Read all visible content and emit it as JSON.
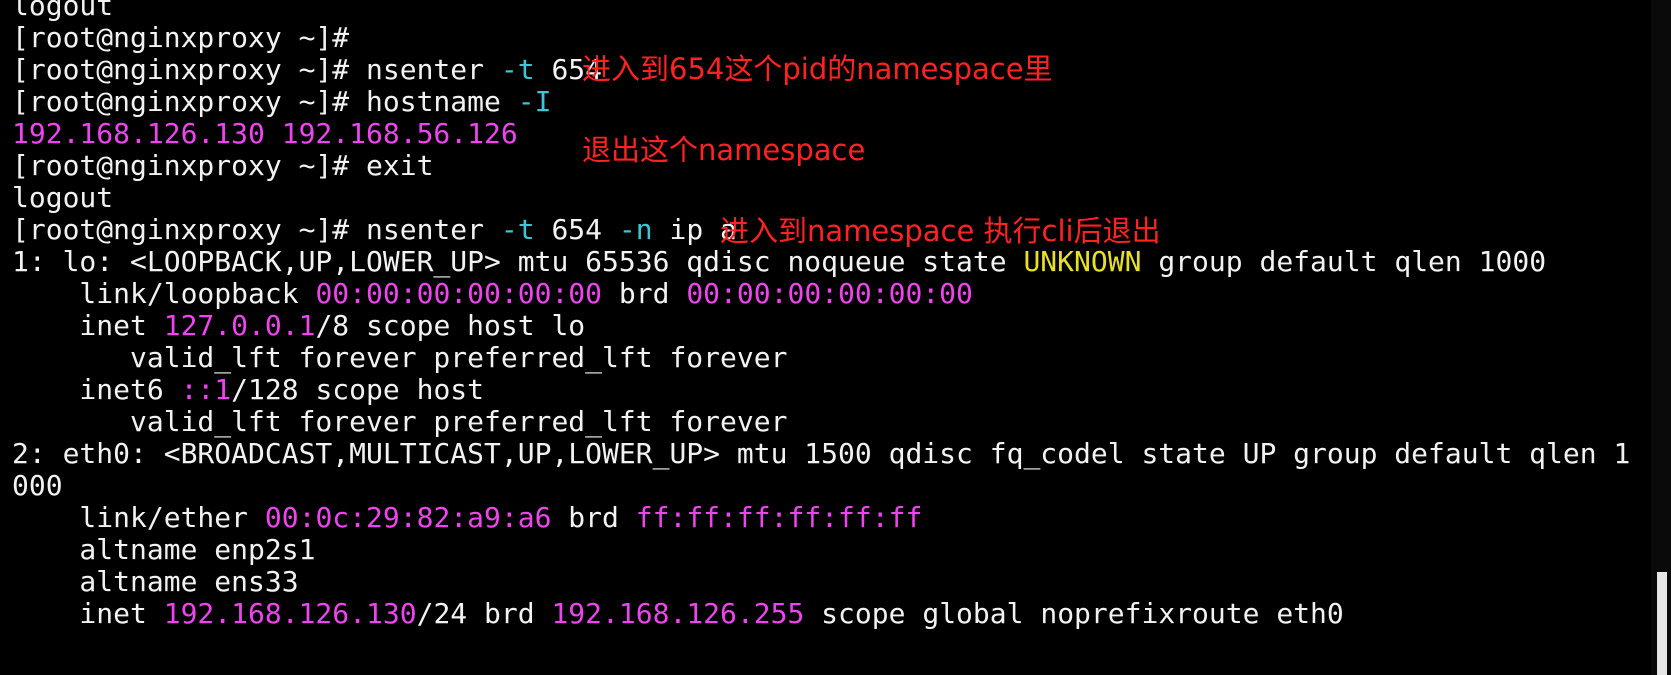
{
  "terminal": {
    "lines": [
      {
        "segments": [
          {
            "text": "logout",
            "style": "cmd"
          }
        ]
      },
      {
        "segments": [
          {
            "text": "[root@nginxproxy ~]#",
            "style": "cmd"
          }
        ]
      },
      {
        "segments": [
          {
            "text": "[root@nginxproxy ~]# nsenter ",
            "style": "cmd"
          },
          {
            "text": "-t",
            "style": "flag"
          },
          {
            "text": " 654",
            "style": "cmd"
          }
        ]
      },
      {
        "segments": [
          {
            "text": "[root@nginxproxy ~]# hostname ",
            "style": "cmd"
          },
          {
            "text": "-I",
            "style": "flag"
          }
        ]
      },
      {
        "segments": [
          {
            "text": "192.168.126.130 192.168.56.126",
            "style": "mag"
          }
        ]
      },
      {
        "segments": [
          {
            "text": "[root@nginxproxy ~]# exit",
            "style": "cmd"
          }
        ]
      },
      {
        "segments": [
          {
            "text": "logout",
            "style": "cmd"
          }
        ]
      },
      {
        "segments": [
          {
            "text": "[root@nginxproxy ~]# nsenter ",
            "style": "cmd"
          },
          {
            "text": "-t",
            "style": "flag"
          },
          {
            "text": " 654 ",
            "style": "cmd"
          },
          {
            "text": "-n",
            "style": "flag"
          },
          {
            "text": " ip a",
            "style": "cmd"
          }
        ]
      },
      {
        "segments": [
          {
            "text": "1: lo: <LOOPBACK,UP,LOWER_UP> mtu 65536 qdisc noqueue state ",
            "style": "cmd"
          },
          {
            "text": "UNKNOWN",
            "style": "yel"
          },
          {
            "text": " group default qlen 1000",
            "style": "cmd"
          }
        ]
      },
      {
        "segments": [
          {
            "text": "    link/loopback ",
            "style": "cmd"
          },
          {
            "text": "00:00:00:00:00:00",
            "style": "mag"
          },
          {
            "text": " brd ",
            "style": "cmd"
          },
          {
            "text": "00:00:00:00:00:00",
            "style": "mag"
          }
        ]
      },
      {
        "segments": [
          {
            "text": "    inet ",
            "style": "cmd"
          },
          {
            "text": "127.0.0.1",
            "style": "mag"
          },
          {
            "text": "/8 scope host lo",
            "style": "cmd"
          }
        ]
      },
      {
        "segments": [
          {
            "text": "       valid_lft forever preferred_lft forever",
            "style": "cmd"
          }
        ]
      },
      {
        "segments": [
          {
            "text": "    inet6 ",
            "style": "cmd"
          },
          {
            "text": "::1",
            "style": "mag"
          },
          {
            "text": "/128 scope host",
            "style": "cmd"
          }
        ]
      },
      {
        "segments": [
          {
            "text": "       valid_lft forever preferred_lft forever",
            "style": "cmd"
          }
        ]
      },
      {
        "segments": [
          {
            "text": "2: eth0: <BROADCAST,MULTICAST,UP,LOWER_UP> mtu 1500 qdisc fq_codel state UP group default qlen 1",
            "style": "cmd"
          }
        ]
      },
      {
        "segments": [
          {
            "text": "000",
            "style": "cmd"
          }
        ]
      },
      {
        "segments": [
          {
            "text": "    link/ether ",
            "style": "cmd"
          },
          {
            "text": "00:0c:29:82:a9:a6",
            "style": "mag"
          },
          {
            "text": " brd ",
            "style": "cmd"
          },
          {
            "text": "ff:ff:ff:ff:ff:ff",
            "style": "mag"
          }
        ]
      },
      {
        "segments": [
          {
            "text": "    altname enp2s1",
            "style": "cmd"
          }
        ]
      },
      {
        "segments": [
          {
            "text": "    altname ens33",
            "style": "cmd"
          }
        ]
      },
      {
        "segments": [
          {
            "text": "    inet ",
            "style": "cmd"
          },
          {
            "text": "192.168.126.130",
            "style": "mag"
          },
          {
            "text": "/24 brd ",
            "style": "cmd"
          },
          {
            "text": "192.168.126.255",
            "style": "mag"
          },
          {
            "text": " scope global noprefixroute eth0",
            "style": "cmd"
          }
        ]
      }
    ]
  },
  "annotations": {
    "enter_pid_namespace": "进入到654这个pid的namespace里",
    "exit_namespace": "退出这个namespace",
    "run_cli_exit": "进入到namespace 执行cli后退出"
  },
  "colors": {
    "background": "#000000",
    "text": "#f2f2f2",
    "flag": "#3fc6d6",
    "highlight_magenta": "#ee44ee",
    "highlight_yellow": "#e8e024",
    "annotation": "#ff2222"
  }
}
